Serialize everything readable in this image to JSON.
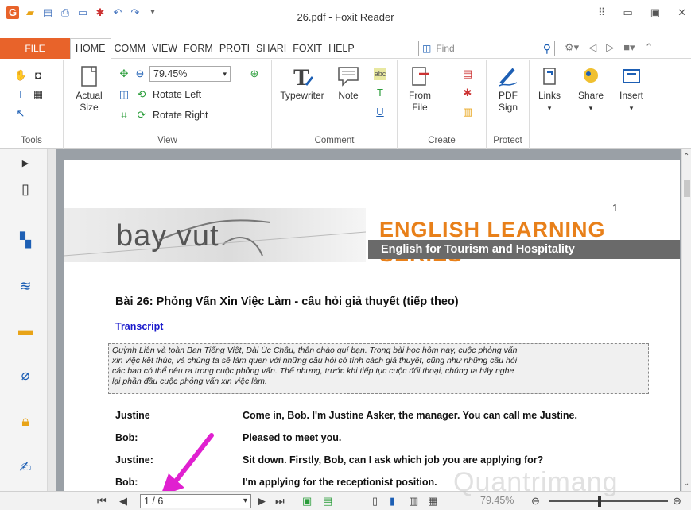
{
  "window": {
    "title": "26.pdf - Foxit Reader"
  },
  "menu": {
    "file": "FILE",
    "tabs": [
      "HOME",
      "COMM",
      "VIEW",
      "FORM",
      "PROTI",
      "SHARI",
      "FOXIT",
      "HELP"
    ],
    "find_placeholder": "Find"
  },
  "ribbon": {
    "tools": {
      "label": "Tools"
    },
    "view": {
      "label": "View",
      "actual_size": "Actual\nSize",
      "zoom_value": "79.45%",
      "rotate_left": "Rotate Left",
      "rotate_right": "Rotate Right"
    },
    "comment": {
      "label": "Comment",
      "typewriter": "Typewriter",
      "note": "Note"
    },
    "create": {
      "label": "Create",
      "from_file": "From\nFile"
    },
    "protect": {
      "label": "Protect",
      "pdf_sign": "PDF\nSign"
    },
    "links": "Links",
    "share": "Share",
    "insert": "Insert"
  },
  "document": {
    "page_number": "1",
    "brand": "bay vut",
    "series": "ENGLISH LEARNING SERIES",
    "subtitle": "English for Tourism and Hospitality",
    "lesson_title": "Bài 26: Phỏng Vấn Xin Việc Làm - câu hỏi giả thuyết (tiếp theo)",
    "transcript_label": "Transcript",
    "intro_lines": [
      "Quỳnh Liên và toàn Ban Tiếng Việt, Đài Úc Châu, thân chào quí bạn. Trong bài học hôm nay, cuộc phỏng vấn",
      "xin việc kết thúc, và chúng ta sẽ làm quen với những câu hỏi có tính cách giả thuyết, cũng như những câu hỏi",
      "các bạn có thể nêu ra trong cuộc phỏng vấn. Thế nhưng, trước khi tiếp tục cuộc đối thoại, chúng ta hãy nghe",
      "lại phần đầu cuộc phỏng vấn xin việc làm."
    ],
    "dialogue": [
      {
        "speaker": "Justine",
        "text": "Come in, Bob. I'm Justine Asker, the manager. You can call me Justine."
      },
      {
        "speaker": "Bob:",
        "text": "Pleased to meet you."
      },
      {
        "speaker": "Justine:",
        "text": "Sit down. Firstly, Bob, can I ask which job you are applying for?"
      },
      {
        "speaker": "Bob:",
        "text": "I'm applying for the receptionist position."
      }
    ]
  },
  "status": {
    "page_field": "1 / 6",
    "zoom": "79.45%"
  },
  "watermark": "Quantrimang"
}
